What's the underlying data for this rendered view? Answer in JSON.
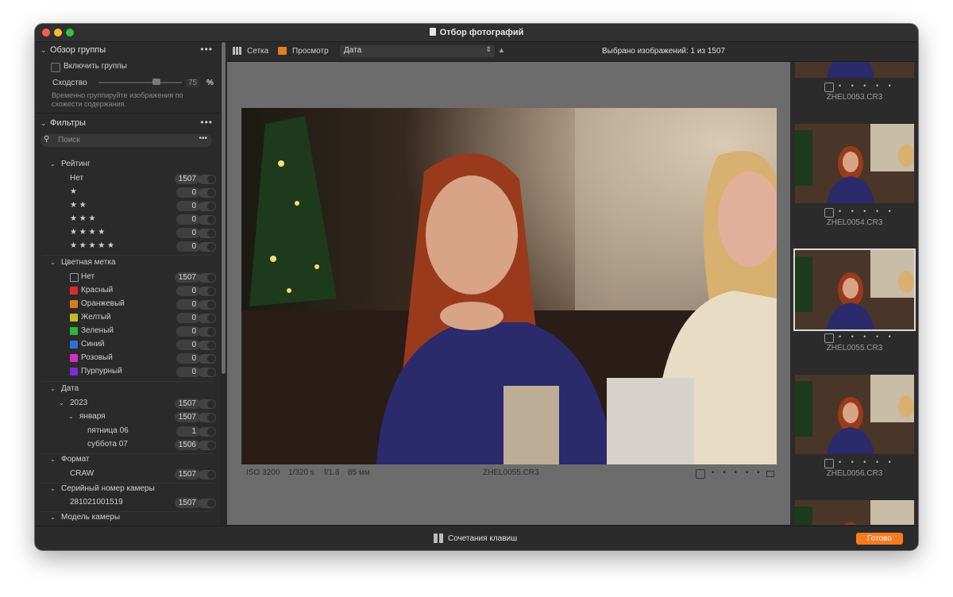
{
  "window": {
    "title": "Отбор фотографий"
  },
  "group_overview": {
    "header": "Обзор группы",
    "more": "•••",
    "enable_groups_label": "Включить группы",
    "similarity_label": "Сходство",
    "similarity_value": "75",
    "similarity_unit": "%",
    "hint_line1": "Временно группируйте изображения по",
    "hint_line2": "схожести содержания."
  },
  "filters": {
    "header": "Фильтры",
    "more": "•••",
    "search_placeholder": "Поиск",
    "search_more": "•••",
    "rating": {
      "header": "Рейтинг",
      "items": [
        {
          "label": "Нет",
          "count": "1507"
        },
        {
          "label": "★",
          "count": "0"
        },
        {
          "label": "★ ★",
          "count": "0"
        },
        {
          "label": "★ ★ ★",
          "count": "0"
        },
        {
          "label": "★ ★ ★ ★",
          "count": "0"
        },
        {
          "label": "★ ★ ★ ★ ★",
          "count": "0"
        }
      ]
    },
    "color_label": {
      "header": "Цветная метка",
      "items": [
        {
          "label": "Нет",
          "count": "1507",
          "color": "none"
        },
        {
          "label": "Красный",
          "count": "0",
          "color": "#d92b2b"
        },
        {
          "label": "Оранжевый",
          "count": "0",
          "color": "#e0791f"
        },
        {
          "label": "Желтый",
          "count": "0",
          "color": "#c8bb1c"
        },
        {
          "label": "Зеленый",
          "count": "0",
          "color": "#29b83c"
        },
        {
          "label": "Синий",
          "count": "0",
          "color": "#2a6fd6"
        },
        {
          "label": "Розовый",
          "count": "0",
          "color": "#d42fc2"
        },
        {
          "label": "Пурпурный",
          "count": "0",
          "color": "#7b2bd6"
        }
      ]
    },
    "date": {
      "header": "Дата",
      "year": {
        "label": "2023",
        "count": "1507"
      },
      "month": {
        "label": "января",
        "count": "1507"
      },
      "days": [
        {
          "label": "пятница 06",
          "count": "1"
        },
        {
          "label": "суббота 07",
          "count": "1506"
        }
      ]
    },
    "format": {
      "header": "Формат",
      "items": [
        {
          "label": "CRAW",
          "count": "1507"
        }
      ]
    },
    "serial": {
      "header": "Серийный номер камеры",
      "items": [
        {
          "label": "281021001519",
          "count": "1507"
        }
      ]
    },
    "model": {
      "header": "Модель камеры"
    }
  },
  "toolbar": {
    "grid_label": "Сетка",
    "view_label": "Просмотр",
    "sort_value": "Дата",
    "selected_info": "Выбрано изображений: 1 из 1507"
  },
  "viewer": {
    "iso": "ISO 3200",
    "shutter": "1/320 s",
    "aperture": "f/1.8",
    "focal": "85 мм",
    "filename": "ZHEL0055.CR3",
    "rating_dots": "• • • • •"
  },
  "filmstrip": [
    {
      "name": "ZHEL0053.CR3",
      "selected": false
    },
    {
      "name": "ZHEL0054.CR3",
      "selected": false
    },
    {
      "name": "ZHEL0055.CR3",
      "selected": true
    },
    {
      "name": "ZHEL0056.CR3",
      "selected": false
    }
  ],
  "filmstrip_dots": "• • • • •",
  "bottom": {
    "shortcuts_label": "Сочетания клавиш",
    "done_label": "Готово"
  }
}
